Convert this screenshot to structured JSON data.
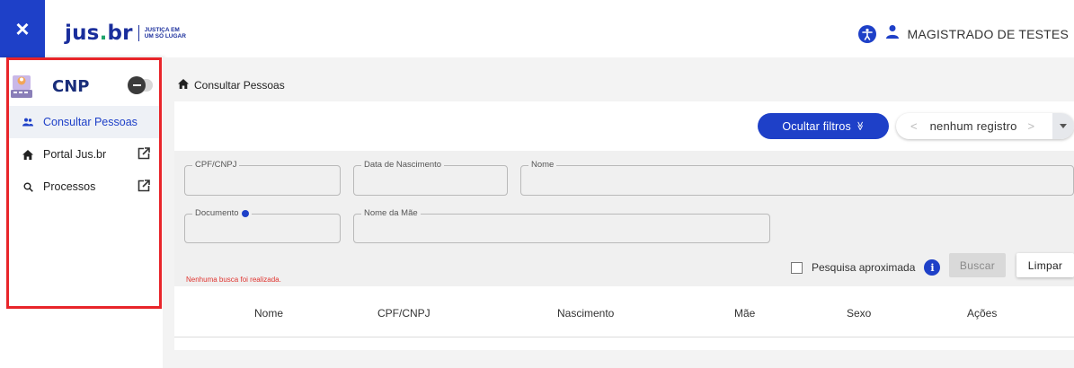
{
  "topbar": {
    "close_icon": "×",
    "logo_main": "jus",
    "logo_dot": ".",
    "logo_br": "br",
    "logo_tag_line1": "JUSTIÇA EM",
    "logo_tag_line2": "UM SÓ LUGAR",
    "user_name": "MAGISTRADO DE TESTES",
    "brand_color": "#1e40c8"
  },
  "sidebar": {
    "app_title": "CNP",
    "items": [
      {
        "label": "Consultar Pessoas",
        "icon": "people-icon",
        "active": true
      },
      {
        "label": "Portal Jus.br",
        "icon": "home-icon",
        "external": true
      },
      {
        "label": "Processos",
        "icon": "search-icon",
        "external": true
      }
    ]
  },
  "breadcrumb": {
    "label": "Consultar Pessoas"
  },
  "toolbar": {
    "filters_button": "Ocultar filtros",
    "filters_icon": "≫",
    "pager_prev": "<",
    "pager_text": "nenhum registro",
    "pager_next": ">"
  },
  "form": {
    "cpf_label": "CPF/CNPJ",
    "nascimento_label": "Data de Nascimento",
    "nome_label": "Nome",
    "documento_label": "Documento",
    "mae_label": "Nome da Mãe",
    "aprox_label": "Pesquisa aproximada",
    "buscar_label": "Buscar",
    "limpar_label": "Limpar",
    "warning": "Nenhuma busca foi realizada."
  },
  "table": {
    "columns": [
      "Nome",
      "CPF/CNPJ",
      "Nascimento",
      "Mãe",
      "Sexo",
      "Ações"
    ]
  }
}
